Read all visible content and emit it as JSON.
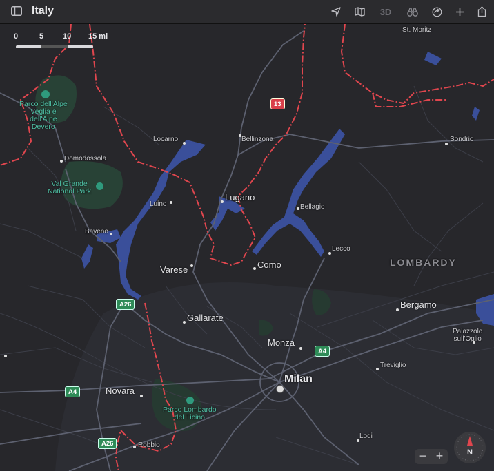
{
  "toolbar": {
    "title": "Italy",
    "three_d_label": "3D"
  },
  "scale": {
    "ticks": [
      "0",
      "5",
      "10",
      "15 mi"
    ]
  },
  "labels": {
    "st_moritz": "St. Moritz",
    "park_veglia": "Parco dell'Alpe\nVeglia e\ndell'Alpe\nDevero",
    "locarno": "Locarno",
    "bellinzona": "Bellinzona",
    "sondrio": "Sondrio",
    "domodossola": "Domodossola",
    "val_grande": "Val Grande\nNational Park",
    "lugano": "Lugano",
    "luino": "Luino",
    "bellagio": "Bellagio",
    "baveno": "Baveno",
    "lecco": "Lecco",
    "lombardy": "LOMBARDY",
    "varese": "Varese",
    "como": "Como",
    "bergamo": "Bergamo",
    "gallarate": "Gallarate",
    "monza": "Monza",
    "palazzolo": "Palazzolo\nsull'Oglio",
    "treviglio": "Treviglio",
    "milan": "Milan",
    "novara": "Novara",
    "parco_ticino": "Parco Lombardo\ndel Ticino",
    "lodi": "Lodi",
    "robbio": "Robbio"
  },
  "shields": {
    "r13": "13",
    "a26_top": "A26",
    "a4_right": "A4",
    "a4_left": "A4",
    "a26_bottom": "A26"
  },
  "zoom": {
    "minus": "−",
    "plus": "+"
  },
  "compass": {
    "label": "N"
  },
  "colors": {
    "water": "#3a4f9a",
    "border": "#e0464e",
    "park": "#284236",
    "road": "#4a4c58",
    "highway": "#5d6170"
  },
  "icons": [
    "sidebar-icon",
    "location-arrow-icon",
    "map-icon",
    "binoculars-icon",
    "refresh-icon",
    "plus-icon",
    "share-icon",
    "tree-icon",
    "milan-city-icon"
  ]
}
